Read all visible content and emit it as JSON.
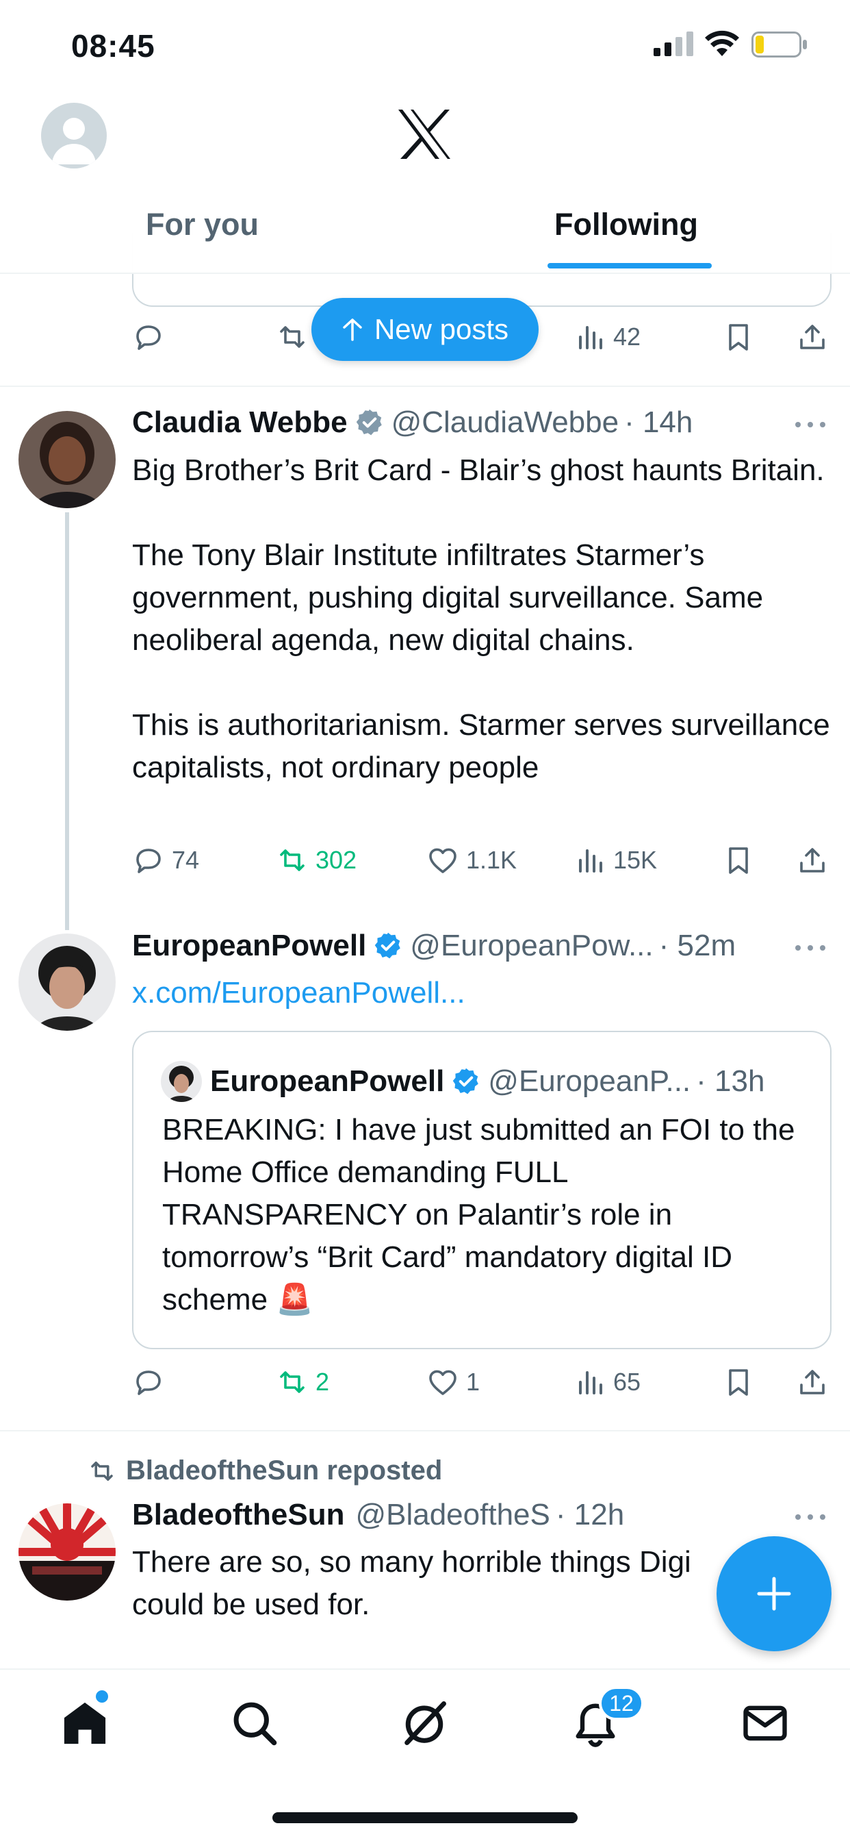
{
  "status_bar": {
    "time": "08:45"
  },
  "header": {
    "tabs": [
      {
        "label": "For you",
        "active": false
      },
      {
        "label": "Following",
        "active": true
      }
    ]
  },
  "new_posts_label": "New posts",
  "previous_post": {
    "views": "42"
  },
  "posts": [
    {
      "name": "Claudia Webbe",
      "handle": "@ClaudiaWebbe",
      "time": "· 14h",
      "text": "Big Brother’s Brit Card - Blair’s ghost haunts Britain.\n\nThe Tony Blair Institute infiltrates Starmer’s government, pushing digital surveillance. Same neoliberal agenda, new digital chains.\n\nThis is authoritarianism. Starmer serves surveillance capitalists, not ordinary people",
      "replies": "74",
      "reposts": "302",
      "likes": "1.1K",
      "views": "15K"
    },
    {
      "name": "EuropeanPowell",
      "handle": "@EuropeanPow...",
      "time": "· 52m",
      "link": "x.com/EuropeanPowell...",
      "quote": {
        "name": "EuropeanPowell",
        "handle": "@EuropeanP...",
        "time": "· 13h",
        "text": "BREAKING: I have just submitted an FOI to the Home Office demanding FULL TRANSPARENCY on Palantir’s role in tomorrow’s “Brit Card” mandatory digital ID scheme 🚨"
      },
      "replies": "",
      "reposts": "2",
      "likes": "1",
      "views": "65"
    },
    {
      "reposted_by": "BladeoftheSun reposted",
      "name": "BladeoftheSun",
      "handle": "@BladeoftheS",
      "time": "· 12h",
      "text": "There are so, so many horrible things Digi could be used for."
    }
  ],
  "bottom_nav": {
    "notification_count": "12"
  },
  "colors": {
    "accent": "#1d9bf0",
    "repost_green": "#00ba7c",
    "muted": "#536471",
    "text": "#0f1419"
  }
}
